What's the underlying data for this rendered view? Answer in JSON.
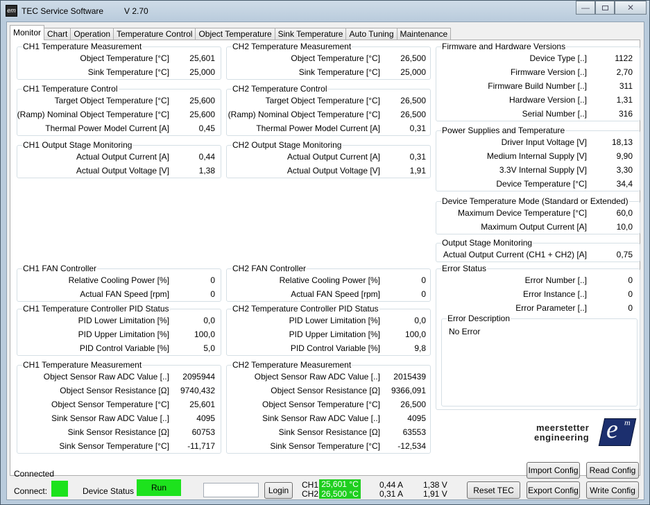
{
  "window": {
    "title": "TEC Service Software",
    "version": "V 2.70",
    "icon": "meerstetter-app-icon",
    "icon_text": "em"
  },
  "tabs": [
    "Monitor",
    "Chart",
    "Operation",
    "Temperature Control",
    "Object Temperature",
    "Sink Temperature",
    "Auto Tuning",
    "Maintenance"
  ],
  "ch1": {
    "temp_meas": {
      "title": "CH1 Temperature Measurement",
      "rows": [
        {
          "label": "Object Temperature [°C]",
          "value": "25,601"
        },
        {
          "label": "Sink Temperature [°C]",
          "value": "25,000"
        }
      ]
    },
    "temp_ctrl": {
      "title": "CH1 Temperature Control",
      "rows": [
        {
          "label": "Target Object Temperature [°C]",
          "value": "25,600"
        },
        {
          "label": "(Ramp) Nominal Object Temperature [°C]",
          "value": "25,600"
        },
        {
          "label": "Thermal Power Model Current [A]",
          "value": "0,45"
        }
      ]
    },
    "output": {
      "title": "CH1 Output Stage Monitoring",
      "rows": [
        {
          "label": "Actual Output Current [A]",
          "value": "0,44"
        },
        {
          "label": "Actual Output Voltage [V]",
          "value": "1,38"
        }
      ]
    },
    "fan": {
      "title": "CH1 FAN Controller",
      "rows": [
        {
          "label": "Relative Cooling Power [%]",
          "value": "0"
        },
        {
          "label": "Actual FAN Speed [rpm]",
          "value": "0"
        }
      ]
    },
    "pid": {
      "title": "CH1 Temperature Controller PID Status",
      "rows": [
        {
          "label": "PID Lower Limitation [%]",
          "value": "0,0"
        },
        {
          "label": "PID Upper Limitation [%]",
          "value": "100,0"
        },
        {
          "label": "PID Control Variable [%]",
          "value": "5,0"
        }
      ]
    },
    "meas2": {
      "title": "CH1 Temperature Measurement",
      "rows": [
        {
          "label": "Object Sensor Raw ADC Value [..]",
          "value": "2095944"
        },
        {
          "label": "Object Sensor Resistance [Ω]",
          "value": "9740,432"
        },
        {
          "label": "Object Sensor Temperature [°C]",
          "value": "25,601"
        },
        {
          "label": "Sink Sensor Raw ADC Value [..]",
          "value": "4095"
        },
        {
          "label": "Sink Sensor Resistance [Ω]",
          "value": "60753"
        },
        {
          "label": "Sink Sensor Temperature [°C]",
          "value": "-11,717"
        }
      ]
    }
  },
  "ch2": {
    "temp_meas": {
      "title": "CH2 Temperature Measurement",
      "rows": [
        {
          "label": "Object Temperature [°C]",
          "value": "26,500"
        },
        {
          "label": "Sink Temperature [°C]",
          "value": "25,000"
        }
      ]
    },
    "temp_ctrl": {
      "title": "CH2 Temperature Control",
      "rows": [
        {
          "label": "Target Object Temperature [°C]",
          "value": "26,500"
        },
        {
          "label": "(Ramp) Nominal Object Temperature [°C]",
          "value": "26,500"
        },
        {
          "label": "Thermal Power Model Current [A]",
          "value": "0,31"
        }
      ]
    },
    "output": {
      "title": "CH2 Output Stage Monitoring",
      "rows": [
        {
          "label": "Actual Output Current [A]",
          "value": "0,31"
        },
        {
          "label": "Actual Output Voltage [V]",
          "value": "1,91"
        }
      ]
    },
    "fan": {
      "title": "CH2 FAN Controller",
      "rows": [
        {
          "label": "Relative Cooling Power [%]",
          "value": "0"
        },
        {
          "label": "Actual FAN Speed [rpm]",
          "value": "0"
        }
      ]
    },
    "pid": {
      "title": "CH2 Temperature Controller PID Status",
      "rows": [
        {
          "label": "PID Lower Limitation [%]",
          "value": "0,0"
        },
        {
          "label": "PID Upper Limitation [%]",
          "value": "100,0"
        },
        {
          "label": "PID Control Variable [%]",
          "value": "9,8"
        }
      ]
    },
    "meas2": {
      "title": "CH2 Temperature Measurement",
      "rows": [
        {
          "label": "Object Sensor Raw ADC Value [..]",
          "value": "2015439"
        },
        {
          "label": "Object Sensor Resistance [Ω]",
          "value": "9366,091"
        },
        {
          "label": "Object Sensor Temperature [°C]",
          "value": "26,500"
        },
        {
          "label": "Sink Sensor Raw ADC Value [..]",
          "value": "4095"
        },
        {
          "label": "Sink Sensor Resistance [Ω]",
          "value": "63553"
        },
        {
          "label": "Sink Sensor Temperature [°C]",
          "value": "-12,534"
        }
      ]
    }
  },
  "right": {
    "firmware": {
      "title": "Firmware and Hardware Versions",
      "rows": [
        {
          "label": "Device Type  [..]",
          "value": "1122"
        },
        {
          "label": "Firmware Version  [..]",
          "value": "2,70"
        },
        {
          "label": "Firmware Build Number [..]",
          "value": "311"
        },
        {
          "label": "Hardware Version [..]",
          "value": "1,31"
        },
        {
          "label": "Serial Number [..]",
          "value": "316"
        }
      ]
    },
    "power": {
      "title": "Power Supplies and Temperature",
      "rows": [
        {
          "label": "Driver Input Voltage [V]",
          "value": "18,13"
        },
        {
          "label": "Medium Internal Supply [V]",
          "value": "9,90"
        },
        {
          "label": "3.3V Internal Supply [V]",
          "value": "3,30"
        },
        {
          "label": "Device Temperature [°C]",
          "value": "34,4"
        }
      ]
    },
    "devtemp": {
      "title": "Device Temperature Mode (Standard or Extended)",
      "rows": [
        {
          "label": "Maximum Device Temperature [°C]",
          "value": "60,0"
        },
        {
          "label": "Maximum Output Current [A]",
          "value": "10,0"
        }
      ]
    },
    "outstage": {
      "title": "Output Stage Monitoring",
      "rows": [
        {
          "label": "Actual Output Current (CH1 + CH2) [A]",
          "value": "0,75"
        }
      ]
    },
    "error": {
      "title": "Error Status",
      "rows": [
        {
          "label": "Error Number [..]",
          "value": "0"
        },
        {
          "label": "Error Instance [..]",
          "value": "0"
        },
        {
          "label": "Error Parameter [..]",
          "value": "0"
        }
      ],
      "desc_title": "Error Description",
      "desc_text": "No Error"
    },
    "logo": {
      "line1": "meerstetter",
      "line2": "engineering",
      "mark": "e",
      "mark_sup": "m"
    }
  },
  "bottom": {
    "connected_text": "Connected",
    "connect_label": "Connect:",
    "device_status_label": "Device Status",
    "device_status_value": "Run",
    "login_value": "",
    "login_button": "Login",
    "ch1_label": "CH1",
    "ch2_label": "CH2",
    "ch1_temp": "25,601 °C",
    "ch2_temp": "26,500 °C",
    "ch1_current": "0,44 A",
    "ch2_current": "0,31 A",
    "ch1_voltage": "1,38 V",
    "ch2_voltage": "1,91 V",
    "reset_tec": "Reset TEC",
    "import_config": "Import Config",
    "export_config": "Export Config",
    "read_config": "Read Config",
    "write_config": "Write Config",
    "status_color": "#1de21d"
  }
}
